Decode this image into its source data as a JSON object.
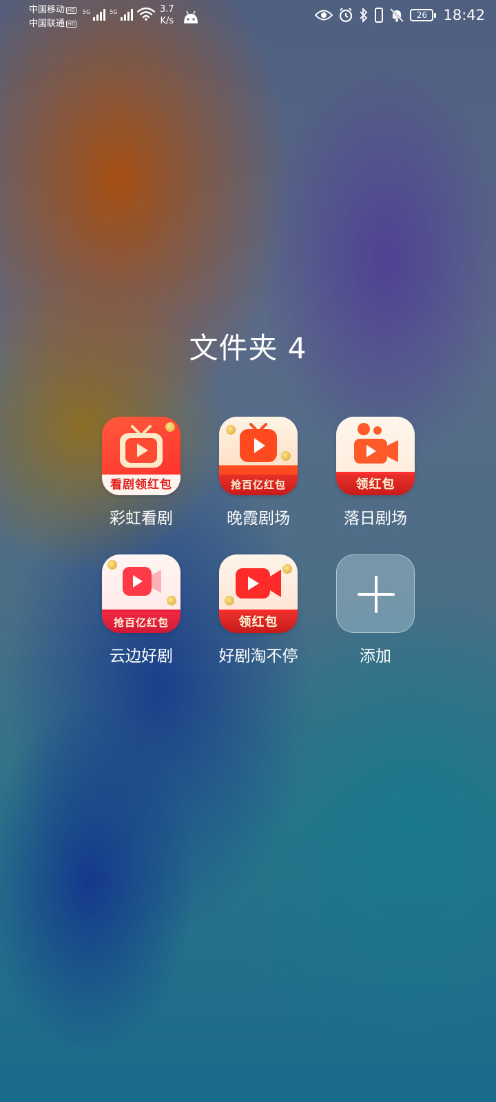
{
  "status_bar": {
    "carrier_1": "中国移动",
    "carrier_2": "中国联通",
    "hd_badge": "HD",
    "network_1": "5G",
    "network_2": "5G",
    "speed_value": "3.7",
    "speed_unit": "K/s",
    "battery_level": "26",
    "time": "18:42",
    "icons": [
      "eye-icon",
      "alarm-icon",
      "bluetooth-icon",
      "mute-bell-icon",
      "battery-icon"
    ]
  },
  "folder": {
    "title": "文件夹 4",
    "apps": [
      {
        "label": "彩虹看剧",
        "banner": "看剧领红包",
        "accent": "#ff3b30"
      },
      {
        "label": "晚霞剧场",
        "banner": "抢百亿红包",
        "accent": "#ff4a2a"
      },
      {
        "label": "落日剧场",
        "banner": "领红包",
        "accent": "#ff5a2a"
      },
      {
        "label": "云边好剧",
        "banner": "抢百亿红包",
        "accent": "#ff4050"
      },
      {
        "label": "好剧淘不停",
        "banner": "领红包",
        "accent": "#ff3030"
      },
      {
        "label": "添加",
        "banner": "",
        "accent": "#ffffff"
      }
    ]
  }
}
